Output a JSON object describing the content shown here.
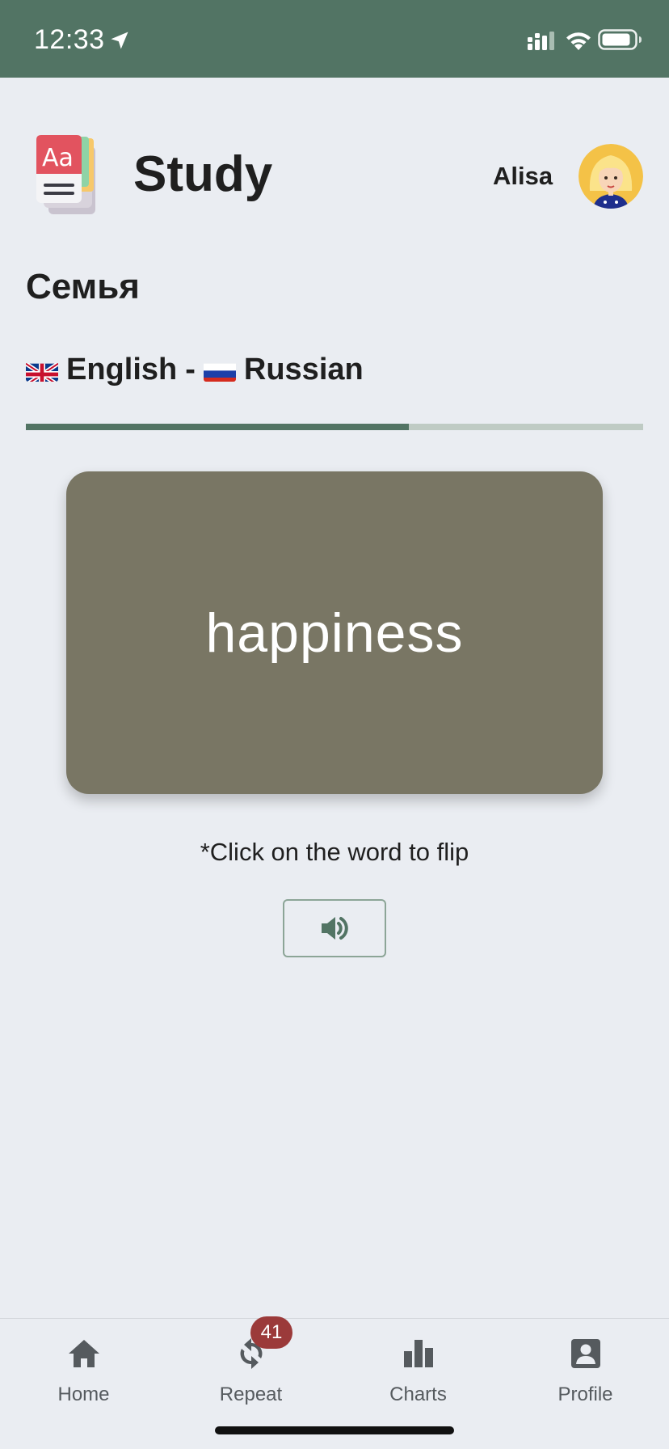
{
  "status_bar": {
    "time": "12:33",
    "icons": [
      "location-arrow-icon",
      "signal-icon",
      "wifi-icon",
      "battery-icon"
    ]
  },
  "header": {
    "title": "Study",
    "user_name": "Alisa",
    "logo_icon": "dictionary-book-icon",
    "avatar": "user-avatar"
  },
  "deck": {
    "title": "Семья",
    "source_language": "English",
    "separator": "-",
    "target_language": "Russian",
    "source_flag": "gb-flag-icon",
    "target_flag": "ru-flag-icon",
    "progress": 0.62
  },
  "card": {
    "word": "happiness",
    "color": "#797664"
  },
  "hint": "*Click on the word to flip",
  "speaker_icon": "speaker-volume-icon",
  "tabs": [
    {
      "label": "Home",
      "icon": "home-icon"
    },
    {
      "label": "Repeat",
      "icon": "repeat-icon",
      "badge": "41"
    },
    {
      "label": "Charts",
      "icon": "bar-chart-icon"
    },
    {
      "label": "Profile",
      "icon": "profile-icon"
    }
  ],
  "colors": {
    "accent": "#527464",
    "background": "#eaedf2",
    "badge": "#9b3a3a"
  }
}
